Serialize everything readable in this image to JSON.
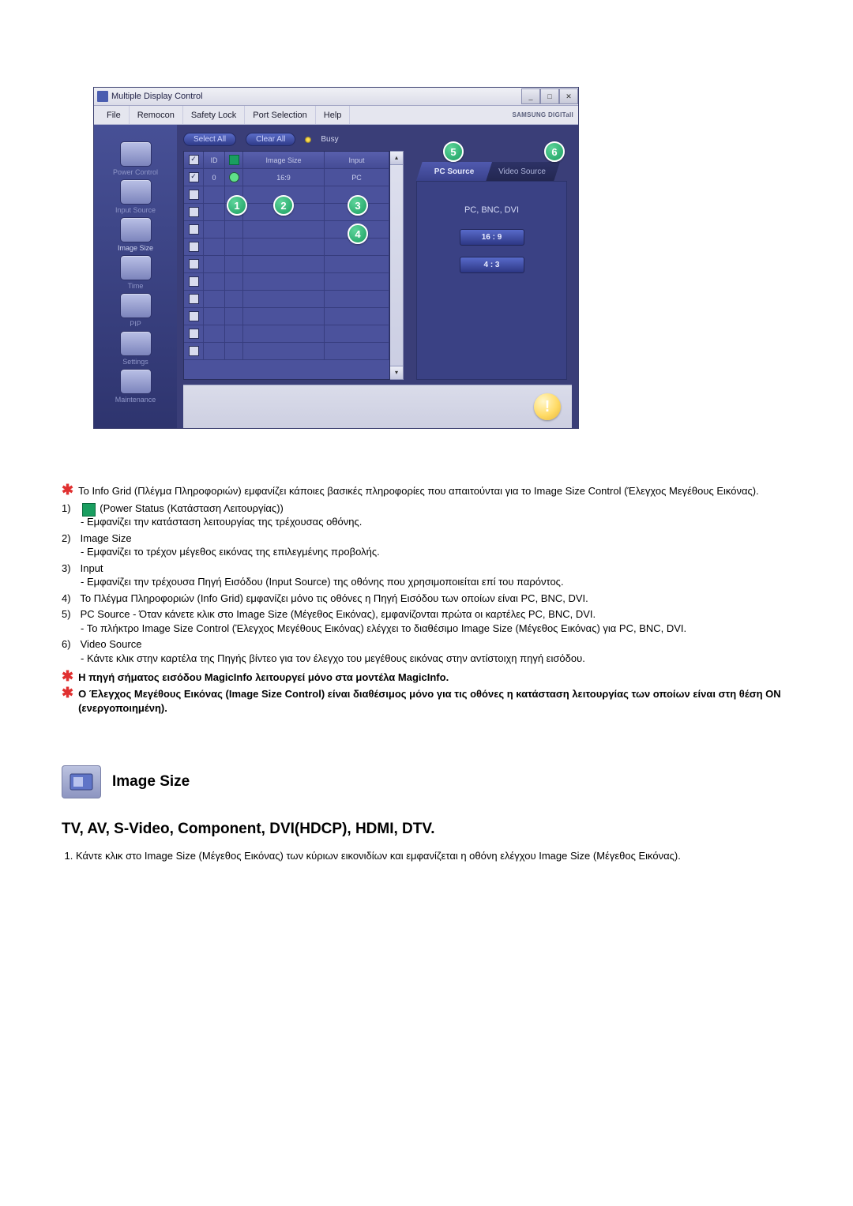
{
  "window": {
    "title": "Multiple Display Control",
    "brand": "SAMSUNG DIGITall"
  },
  "menubar": {
    "file": "File",
    "remocon": "Remocon",
    "safety": "Safety Lock",
    "port": "Port Selection",
    "help": "Help"
  },
  "sidebar": {
    "items": [
      {
        "label": "Power Control"
      },
      {
        "label": "Input Source"
      },
      {
        "label": "Image Size"
      },
      {
        "label": "Time"
      },
      {
        "label": "PIP"
      },
      {
        "label": "Settings"
      },
      {
        "label": "Maintenance"
      }
    ]
  },
  "topbuttons": {
    "select_all": "Select All",
    "clear_all": "Clear All",
    "busy": "Busy"
  },
  "grid": {
    "head_id": "ID",
    "head_size": "Image Size",
    "head_input": "Input",
    "row0_id": "0",
    "row0_size": "16:9",
    "row0_input": "PC"
  },
  "tabs": {
    "pc": "PC Source",
    "video": "Video Source"
  },
  "panel": {
    "title": "PC, BNC, DVI",
    "btn1": "16 : 9",
    "btn2": "4 : 3"
  },
  "markers": {
    "m1": "1",
    "m2": "2",
    "m3": "3",
    "m4": "4",
    "m5": "5",
    "m6": "6"
  },
  "info_ball": "!",
  "notes": {
    "intro": "Το Info Grid (Πλέγμα Πληροφοριών) εμφανίζει κάποιες βασικές πληροφορίες που απαιτούνται για το Image Size Control (Έλεγχος Μεγέθους Εικόνας).",
    "n1_head": "1)",
    "n1_title": "(Power Status (Κατάσταση Λειτουργίας))",
    "n1_sub": "- Εμφανίζει την κατάσταση λειτουργίας της τρέχουσας οθόνης.",
    "n2_head": "2)",
    "n2_title": "Image Size",
    "n2_sub": "- Εμφανίζει το τρέχον μέγεθος εικόνας της επιλεγμένης προβολής.",
    "n3_head": "3)",
    "n3_title": "Input",
    "n3_sub": "- Εμφανίζει την τρέχουσα Πηγή Εισόδου (Input Source) της οθόνης που χρησιμοποιείται επί του παρόντος.",
    "n4_head": "4)",
    "n4_text": "Το Πλέγμα Πληροφοριών (Info Grid) εμφανίζει μόνο τις οθόνες η Πηγή Εισόδου των οποίων είναι PC, BNC, DVI.",
    "n5_head": "5)",
    "n5_text": "PC Source - Όταν κάνετε κλικ στο Image Size (Μέγεθος Εικόνας), εμφανίζονται πρώτα οι καρτέλες PC, BNC, DVI.",
    "n5_sub": "- Το πλήκτρο Image Size Control (Έλεγχος Μεγέθους Εικόνας) ελέγχει το διαθέσιμο Image Size (Μέγεθος Εικόνας) για PC, BNC, DVI.",
    "n6_head": "6)",
    "n6_title": "Video Source",
    "n6_sub": "- Κάντε κλικ στην καρτέλα της Πηγής βίντεο για τον έλεγχο του μεγέθους εικόνας στην αντίστοιχη πηγή εισόδου.",
    "red1": "Η πηγή σήματος εισόδου MagicInfo λειτουργεί μόνο στα μοντέλα MagicInfo.",
    "red2": "Ο Έλεγχος Μεγέθους Εικόνας (Image Size Control) είναι διαθέσιμος μόνο για τις οθόνες η κατάσταση λειτουργίας των οποίων είναι στη θέση ON (ενεργοποιημένη)."
  },
  "section": {
    "title": "Image Size",
    "subheading": "TV, AV, S-Video, Component, DVI(HDCP), HDMI, DTV.",
    "item1": "Κάντε κλικ στο Image Size (Μέγεθος Εικόνας) των κύριων εικονιδίων και εμφανίζεται η οθόνη ελέγχου Image Size (Μέγεθος Εικόνας)."
  }
}
